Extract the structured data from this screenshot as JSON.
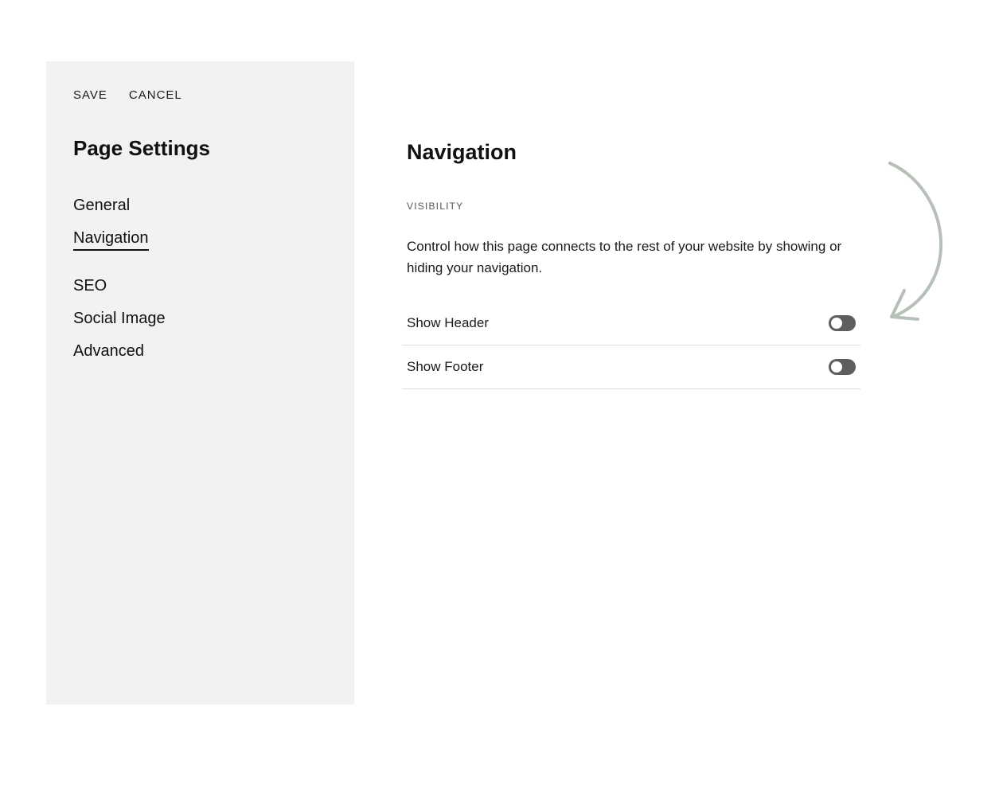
{
  "actions": {
    "save_label": "SAVE",
    "cancel_label": "CANCEL"
  },
  "sidebar": {
    "title": "Page Settings",
    "items": [
      {
        "label": "General",
        "active": false
      },
      {
        "label": "Navigation",
        "active": true
      },
      {
        "label": "SEO",
        "active": false
      },
      {
        "label": "Social Image",
        "active": false
      },
      {
        "label": "Advanced",
        "active": false
      }
    ]
  },
  "main": {
    "title": "Navigation",
    "section_label": "VISIBILITY",
    "description": "Control how this page connects to the rest of your website by showing or hiding your navigation.",
    "toggles": [
      {
        "label": "Show Header",
        "on": false
      },
      {
        "label": "Show Footer",
        "on": false
      }
    ]
  },
  "colors": {
    "sidebar_bg": "#f2f2f2",
    "toggle_off": "#5e5e5e",
    "arrow": "#b7c0b7"
  },
  "icons": {
    "annotation": "curved-arrow-icon"
  }
}
